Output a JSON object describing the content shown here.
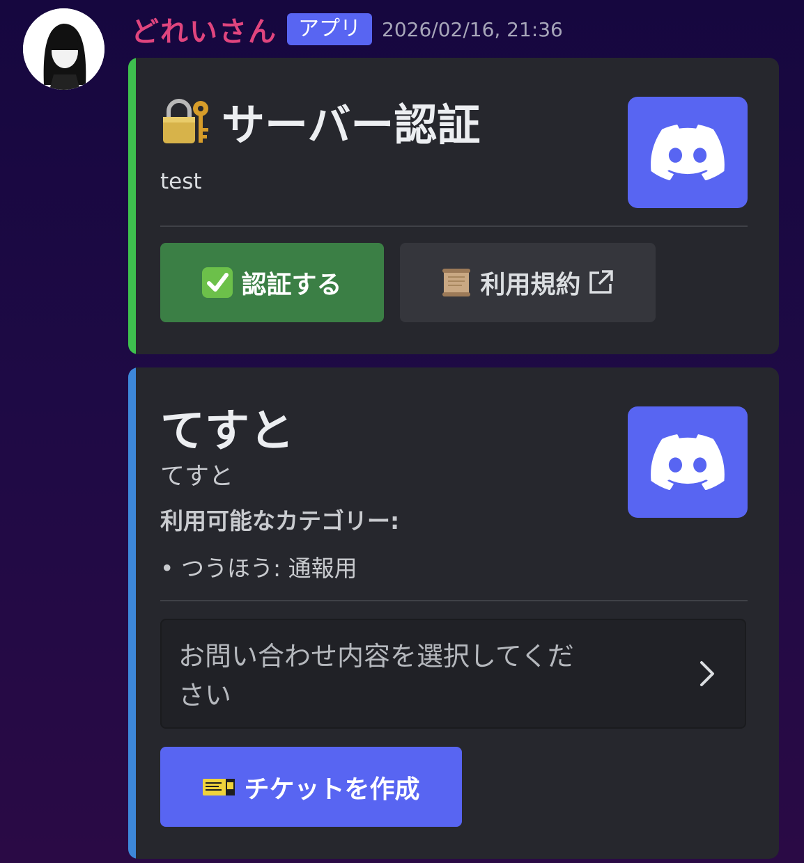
{
  "message": {
    "author": "どれいさん",
    "badge": "アプリ",
    "timestamp": "2026/02/16, 21:36"
  },
  "embed1": {
    "accent_color": "#3ec04e",
    "title": "サーバー認証",
    "title_icon": "lock-with-key-icon",
    "description": "test",
    "thumbnail_icon": "discord-logo-icon",
    "buttons": [
      {
        "label": "認証する",
        "icon": "check-mark-button-icon",
        "color": "#3b7f45"
      },
      {
        "label": "利用規約",
        "icon": "scroll-icon",
        "trailing_icon": "external-link-icon",
        "color": "#35363c"
      }
    ]
  },
  "embed2": {
    "accent_color": "#3d87d9",
    "title": "てすと",
    "description": "てすと",
    "category_label": "利用可能なカテゴリー:",
    "category_item": "• つうほう: 通報用",
    "thumbnail_icon": "discord-logo-icon",
    "select_placeholder": "お問い合わせ内容を選択してください",
    "ticket_button": {
      "label": "チケットを作成",
      "icon": "ticket-icon",
      "color": "#5865f2"
    }
  }
}
